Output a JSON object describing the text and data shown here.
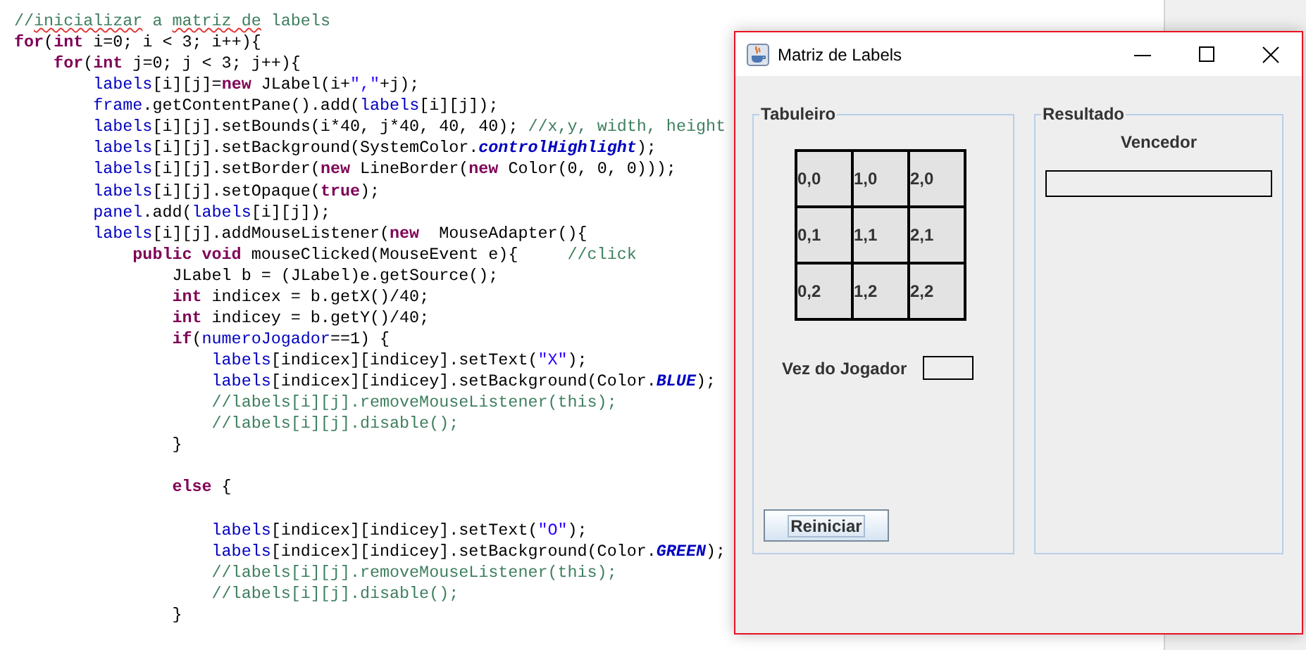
{
  "editor": {
    "lines": [
      [
        {
          "kind": "comment",
          "text": "//"
        },
        {
          "kind": "misspelled",
          "text": "inicializar"
        },
        {
          "kind": "comment",
          "text": " a "
        },
        {
          "kind": "misspelled",
          "text": "matriz"
        },
        {
          "kind": "misspelled",
          "text": " de"
        },
        {
          "kind": "comment",
          "text": " labels"
        }
      ],
      [
        {
          "kind": "keyword",
          "text": "for"
        },
        {
          "kind": "plain",
          "text": "("
        },
        {
          "kind": "keyword",
          "text": "int"
        },
        {
          "kind": "plain",
          "text": " i=0; i < 3; i++){"
        }
      ],
      [
        {
          "kind": "keyword",
          "text": "    for"
        },
        {
          "kind": "plain",
          "text": "("
        },
        {
          "kind": "keyword",
          "text": "int"
        },
        {
          "kind": "plain",
          "text": " j=0; j < 3; j++){"
        }
      ],
      [
        {
          "kind": "field",
          "text": "        labels"
        },
        {
          "kind": "plain",
          "text": "[i][j]="
        },
        {
          "kind": "keyword",
          "text": "new"
        },
        {
          "kind": "plain",
          "text": " JLabel(i+"
        },
        {
          "kind": "string",
          "text": "\",\""
        },
        {
          "kind": "plain",
          "text": "+j);"
        }
      ],
      [
        {
          "kind": "field",
          "text": "        frame"
        },
        {
          "kind": "plain",
          "text": ".getContentPane().add("
        },
        {
          "kind": "field",
          "text": "labels"
        },
        {
          "kind": "plain",
          "text": "[i][j]);"
        }
      ],
      [
        {
          "kind": "field",
          "text": "        labels"
        },
        {
          "kind": "plain",
          "text": "[i][j].setBounds(i*40, j*40, 40, 40); "
        },
        {
          "kind": "comment",
          "text": "//x,y, width, height"
        }
      ],
      [
        {
          "kind": "field",
          "text": "        labels"
        },
        {
          "kind": "plain",
          "text": "[i][j].setBackground(SystemColor."
        },
        {
          "kind": "constant",
          "text": "controlHighlight"
        },
        {
          "kind": "plain",
          "text": ");"
        }
      ],
      [
        {
          "kind": "field",
          "text": "        labels"
        },
        {
          "kind": "plain",
          "text": "[i][j].setBorder("
        },
        {
          "kind": "keyword",
          "text": "new"
        },
        {
          "kind": "plain",
          "text": " LineBorder("
        },
        {
          "kind": "keyword",
          "text": "new"
        },
        {
          "kind": "plain",
          "text": " Color(0, 0, 0)));"
        }
      ],
      [
        {
          "kind": "field",
          "text": "        labels"
        },
        {
          "kind": "plain",
          "text": "[i][j].setOpaque("
        },
        {
          "kind": "keyword",
          "text": "true"
        },
        {
          "kind": "plain",
          "text": ");"
        }
      ],
      [
        {
          "kind": "field",
          "text": "        panel"
        },
        {
          "kind": "plain",
          "text": ".add("
        },
        {
          "kind": "field",
          "text": "labels"
        },
        {
          "kind": "plain",
          "text": "[i][j]);"
        }
      ],
      [
        {
          "kind": "field",
          "text": "        labels"
        },
        {
          "kind": "plain",
          "text": "[i][j].addMouseListener("
        },
        {
          "kind": "keyword",
          "text": "new"
        },
        {
          "kind": "plain",
          "text": "  MouseAdapter(){"
        }
      ],
      [
        {
          "kind": "keyword",
          "text": "            public void"
        },
        {
          "kind": "plain",
          "text": " mouseClicked(MouseEvent e){     "
        },
        {
          "kind": "comment",
          "text": "//click"
        }
      ],
      [
        {
          "kind": "plain",
          "text": "                JLabel b = (JLabel)e.getSource();"
        }
      ],
      [
        {
          "kind": "keyword",
          "text": "                int"
        },
        {
          "kind": "plain",
          "text": " indicex = b.getX()/40;"
        }
      ],
      [
        {
          "kind": "keyword",
          "text": "                int"
        },
        {
          "kind": "plain",
          "text": " indicey = b.getY()/40;"
        }
      ],
      [
        {
          "kind": "keyword",
          "text": "                if"
        },
        {
          "kind": "plain",
          "text": "("
        },
        {
          "kind": "field",
          "text": "numeroJogador"
        },
        {
          "kind": "plain",
          "text": "==1) {"
        }
      ],
      [
        {
          "kind": "field",
          "text": "                    labels"
        },
        {
          "kind": "plain",
          "text": "[indicex][indicey].setText("
        },
        {
          "kind": "string",
          "text": "\"X\""
        },
        {
          "kind": "plain",
          "text": ");"
        }
      ],
      [
        {
          "kind": "field",
          "text": "                    labels"
        },
        {
          "kind": "plain",
          "text": "[indicex][indicey].setBackground(Color."
        },
        {
          "kind": "constant",
          "text": "BLUE"
        },
        {
          "kind": "plain",
          "text": ");"
        }
      ],
      [
        {
          "kind": "comment",
          "text": "                    //labels[i][j].removeMouseListener(this);"
        }
      ],
      [
        {
          "kind": "comment",
          "text": "                    //labels[i][j].disable();"
        }
      ],
      [
        {
          "kind": "plain",
          "text": "                }"
        }
      ],
      [
        {
          "kind": "keyword",
          "text": "                else",
          "blank_line_before": true
        },
        {
          "kind": "plain",
          "text": " {"
        }
      ],
      [
        {
          "kind": "field",
          "text": "                    labels",
          "blank_line_before": true
        },
        {
          "kind": "plain",
          "text": "[indicex][indicey].setText("
        },
        {
          "kind": "string",
          "text": "\"O\""
        },
        {
          "kind": "plain",
          "text": ");"
        }
      ],
      [
        {
          "kind": "field",
          "text": "                    labels"
        },
        {
          "kind": "plain",
          "text": "[indicex][indicey].setBackground(Color."
        },
        {
          "kind": "constant",
          "text": "GREEN"
        },
        {
          "kind": "plain",
          "text": ");"
        }
      ],
      [
        {
          "kind": "comment",
          "text": "                    //labels[i][j].removeMouseListener(this);"
        }
      ],
      [
        {
          "kind": "comment",
          "text": "                    //labels[i][j].disable();"
        }
      ],
      [
        {
          "kind": "plain",
          "text": "                }"
        }
      ]
    ]
  },
  "window": {
    "title": "Matriz de Labels",
    "board": {
      "title": "Tabuleiro",
      "rows": [
        [
          "0,0",
          "1,0",
          "2,0"
        ],
        [
          "0,1",
          "1,1",
          "2,1"
        ],
        [
          "0,2",
          "1,2",
          "2,2"
        ]
      ],
      "turn_label": "Vez do Jogador",
      "restart_button": "Reiniciar"
    },
    "result": {
      "title": "Resultado",
      "winner_label": "Vencedor"
    }
  }
}
